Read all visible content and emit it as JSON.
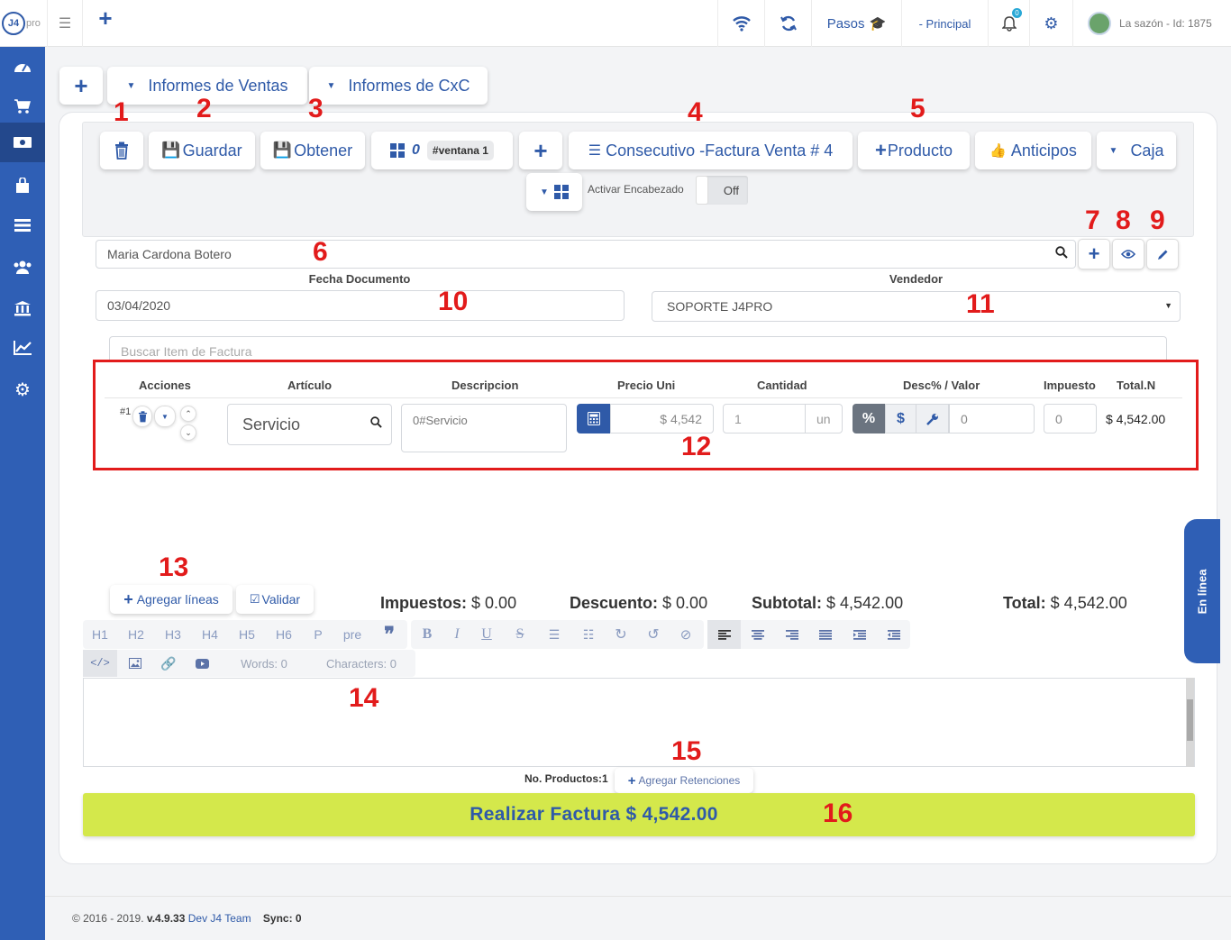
{
  "topbar": {
    "logo": "J4",
    "logo_suffix": "pro",
    "pasos": "Pasos",
    "principal": "- Principal",
    "notif_count": "0",
    "user": "La sazón - Id: 1875"
  },
  "tabs": {
    "ventas": "Informes de Ventas",
    "cxc": "Informes de CxC"
  },
  "toolbar": {
    "guardar": "Guardar",
    "obtener": "Obtener",
    "ventana_count": "0",
    "ventana_tag": "#ventana 1",
    "consecutivo": "Consecutivo -Factura Venta # 4",
    "producto": "Producto",
    "anticipos": "Anticipos",
    "caja": "Caja",
    "activar": "Activar Encabezado",
    "toggle": "Off"
  },
  "form": {
    "cliente": "Maria Cardona Botero",
    "fecha_label": "Fecha Documento",
    "fecha": "03/04/2020",
    "vendedor_label": "Vendedor",
    "vendedor": "SOPORTE J4PRO",
    "buscar_placeholder": "Buscar Item de Factura"
  },
  "table": {
    "headers": {
      "acciones": "Acciones",
      "articulo": "Artículo",
      "descripcion": "Descripcion",
      "precio": "Precio Uni",
      "cantidad": "Cantidad",
      "desc": "Desc% / Valor",
      "impuesto": "Impuesto",
      "total": "Total.N"
    },
    "row": {
      "num": "#1",
      "articulo": "Servicio",
      "descripcion": "0#Servicio",
      "precio": "$ 4,542",
      "cantidad": "1",
      "unidad": "un",
      "desc_valor": "0",
      "impuesto": "0",
      "total": "$ 4,542.00"
    }
  },
  "actions": {
    "agregar": "Agregar líneas",
    "validar": "Validar"
  },
  "totals": {
    "impuestos_label": "Impuestos:",
    "impuestos": "$ 0.00",
    "descuento_label": "Descuento:",
    "descuento": "$ 0.00",
    "subtotal_label": "Subtotal:",
    "subtotal": "$ 4,542.00",
    "total_label": "Total:",
    "total": "$ 4,542.00"
  },
  "editor": {
    "headings": [
      "H1",
      "H2",
      "H3",
      "H4",
      "H5",
      "H6",
      "P",
      "pre"
    ],
    "words": "Words: 0",
    "characters": "Characters: 0"
  },
  "footer_row": {
    "productos": "No. Productos:1",
    "retenciones": "Agregar Retenciones"
  },
  "realizar": "Realizar Factura $ 4,542.00",
  "en_linea": "En línea",
  "footer": {
    "copy": "© 2016 - 2019.",
    "version": "v.4.9.33",
    "team": "Dev J4 Team",
    "sync": "Sync: 0"
  },
  "annotations": [
    "1",
    "2",
    "3",
    "4",
    "5",
    "6",
    "7",
    "8",
    "9",
    "10",
    "11",
    "12",
    "13",
    "14",
    "15",
    "16"
  ],
  "colors": {
    "primary": "#2f5aa8",
    "sidebar": "#2f5fb5",
    "accent_green": "#d4e84b",
    "annotation_red": "#e21b1b"
  }
}
